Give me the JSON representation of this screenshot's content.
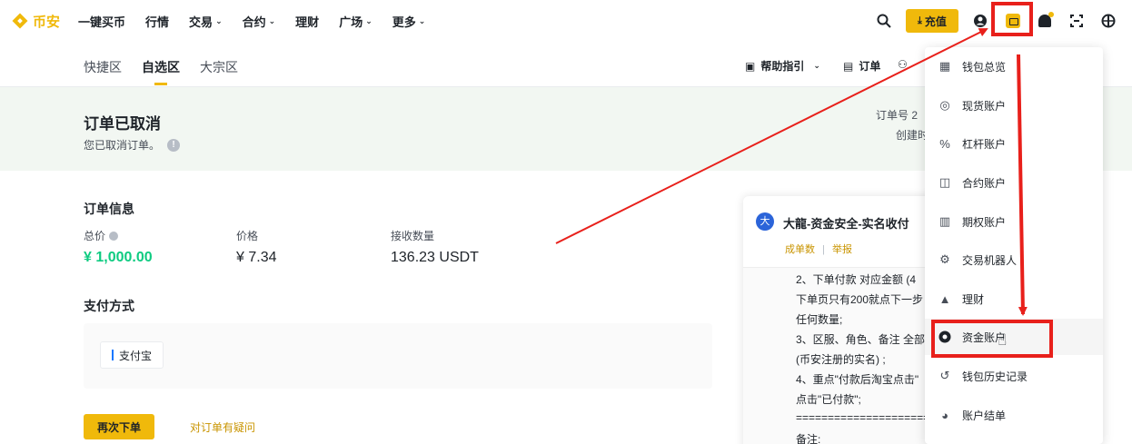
{
  "nav": {
    "logo_text": "币安",
    "items": [
      {
        "label": "一键买币",
        "caret": ""
      },
      {
        "label": "行情",
        "caret": ""
      },
      {
        "label": "交易",
        "caret": "⌄"
      },
      {
        "label": "合约",
        "caret": "⌄"
      },
      {
        "label": "理财",
        "caret": ""
      },
      {
        "label": "广场",
        "caret": "⌄"
      },
      {
        "label": "更多",
        "caret": "⌄"
      }
    ],
    "deposit_label": "充值"
  },
  "subnav": {
    "tabs": [
      "快捷区",
      "自选区",
      "大宗区"
    ],
    "active_tab": "自选区",
    "help_label": "帮助指引",
    "orders_label": "订单"
  },
  "status": {
    "title": "订单已取消",
    "subtitle": "您已取消订单。",
    "order_no_label": "订单号 2",
    "created_label": "创建时"
  },
  "order_info": {
    "title": "订单信息",
    "total_label": "总价",
    "total_value": "¥ 1,000.00",
    "price_label": "价格",
    "price_value": "¥ 7.34",
    "qty_label": "接收数量",
    "qty_value": "136.23 USDT"
  },
  "payment": {
    "title": "支付方式",
    "method": "支付宝"
  },
  "actions": {
    "reorder": "再次下单",
    "question": "对订单有疑问"
  },
  "chat": {
    "avatar": "大",
    "name": "大龍-资金安全-实名收付",
    "link1": "成单数",
    "link2": "举报",
    "lines": [
      "2、下单付款 对应金额 (4",
      "下单页只有200就点下一步",
      "任何数量;",
      "3、区服、角色、备注 全部",
      "(币安注册的实名) ;",
      "4、重点\"付款后淘宝点击\"",
      "点击\"已付款\";",
      "=====================",
      "备注:"
    ]
  },
  "wallet_menu": {
    "items": [
      {
        "label": "钱包总览",
        "icon": "grid-icon"
      },
      {
        "label": "现货账户",
        "icon": "coins-icon"
      },
      {
        "label": "杠杆账户",
        "icon": "percent-icon"
      },
      {
        "label": "合约账户",
        "icon": "contract-icon"
      },
      {
        "label": "期权账户",
        "icon": "options-icon"
      },
      {
        "label": "交易机器人",
        "icon": "robot-icon"
      },
      {
        "label": "理财",
        "icon": "piggy-icon"
      },
      {
        "label": "资金账户",
        "icon": "funding-icon"
      },
      {
        "label": "钱包历史记录",
        "icon": "history-icon"
      },
      {
        "label": "账户结单",
        "icon": "statement-icon"
      }
    ],
    "highlighted": "资金账户"
  },
  "colors": {
    "brand": "#f0b90b",
    "up_green": "#0ecb81",
    "annotation_red": "#e8201b"
  }
}
